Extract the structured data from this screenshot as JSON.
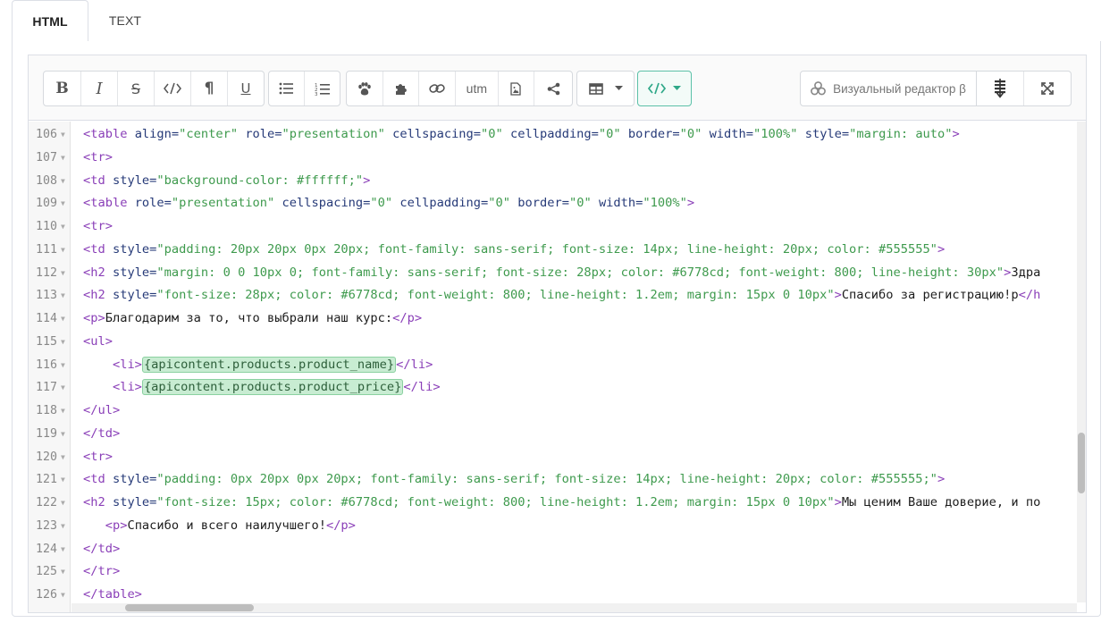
{
  "tabs": [
    {
      "label": "HTML"
    },
    {
      "label": "TEXT"
    }
  ],
  "toolbar": {
    "format_buttons": {
      "bold": "B",
      "italic": "I",
      "strike": "S",
      "paragraph": "¶",
      "underline": "U"
    },
    "utm_label": "utm",
    "visual_editor_label": "Визуальный редактор β",
    "accent_color": "#2fa888"
  },
  "code_lines": [
    {
      "num": "106",
      "seg": [
        "<table",
        " align=",
        "\"center\"",
        " role=",
        "\"presentation\"",
        " cellspacing=",
        "\"0\"",
        " cellpadding=",
        "\"0\"",
        " border=",
        "\"0\"",
        " width=",
        "\"100%\"",
        " style=",
        "\"margin: auto\"",
        ">"
      ]
    },
    {
      "num": "107",
      "text": "<tr>"
    },
    {
      "num": "108",
      "seg": [
        "<td",
        " style=",
        "\"background-color: #ffffff;\"",
        ">"
      ]
    },
    {
      "num": "109",
      "seg": [
        "<table",
        " role=",
        "\"presentation\"",
        " cellspacing=",
        "\"0\"",
        " cellpadding=",
        "\"0\"",
        " border=",
        "\"0\"",
        " width=",
        "\"100%\"",
        ">"
      ]
    },
    {
      "num": "110",
      "text": "<tr>"
    },
    {
      "num": "111",
      "seg": [
        "<td",
        " style=",
        "\"padding: 20px 20px 0px 20px; font-family: sans-serif; font-size: 14px; line-height: 20px; color: #555555\"",
        ">"
      ]
    },
    {
      "num": "112",
      "seg": [
        "<h2",
        " style=",
        "\"margin: 0 0 10px 0; font-family: sans-serif; font-size: 28px; color: #6778cd; font-weight: 800; line-height: 30px\"",
        ">",
        "Здра"
      ]
    },
    {
      "num": "113",
      "seg": [
        "<h2",
        " style=",
        "\"font-size: 28px; color: #6778cd; font-weight: 800; line-height: 1.2em; margin: 15px 0 10px\"",
        ">",
        "Спасибо за регистрацию!р",
        "</h"
      ]
    },
    {
      "num": "114",
      "seg": [
        "<p>",
        "Благодарим за то, что выбрали наш курс:",
        "</p>"
      ]
    },
    {
      "num": "115",
      "text": "<ul>"
    },
    {
      "num": "116",
      "seg": [
        "    <li>",
        "{apicontent.products.product_name}",
        "</li>"
      ]
    },
    {
      "num": "117",
      "seg": [
        "    <li>",
        "{apicontent.products.product_price}",
        "</li>"
      ]
    },
    {
      "num": "118",
      "text": "</ul>"
    },
    {
      "num": "119",
      "text": "</td>"
    },
    {
      "num": "120",
      "text": "<tr>"
    },
    {
      "num": "121",
      "seg": [
        "<td",
        " style=",
        "\"padding: 0px 20px 0px 20px; font-family: sans-serif; font-size: 14px; line-height: 20px; color: #555555;\"",
        ">"
      ]
    },
    {
      "num": "122",
      "seg": [
        "<h2",
        " style=",
        "\"font-size: 15px; color: #6778cd; font-weight: 800; line-height: 1.2em; margin: 15px 0 10px\"",
        ">",
        "Мы ценим Ваше доверие, и по"
      ]
    },
    {
      "num": "123",
      "seg": [
        "   <p>",
        "Спасибо и всего наилучшего!",
        "</p>"
      ]
    },
    {
      "num": "124",
      "text": "</td>"
    },
    {
      "num": "125",
      "text": "</tr>"
    },
    {
      "num": "126",
      "text": "</table>"
    }
  ]
}
